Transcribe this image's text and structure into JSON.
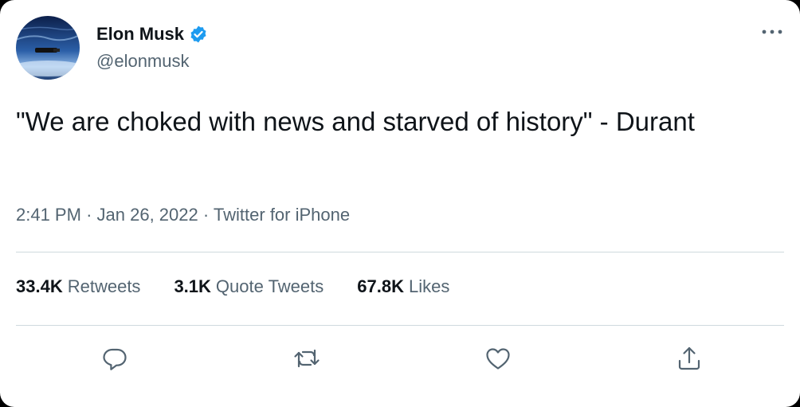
{
  "user": {
    "display_name": "Elon Musk",
    "handle": "@elonmusk",
    "verified": true,
    "avatar_icon": "avatar-earth-from-space"
  },
  "tweet": {
    "text": "\"We are choked with news and starved of history\" - Durant"
  },
  "meta": {
    "time": "2:41 PM",
    "separator_1": "·",
    "date": "Jan 26, 2022",
    "separator_2": "·",
    "source": "Twitter for iPhone"
  },
  "stats": {
    "retweets": {
      "count": "33.4K",
      "label": "Retweets"
    },
    "quote_tweets": {
      "count": "3.1K",
      "label": "Quote Tweets"
    },
    "likes": {
      "count": "67.8K",
      "label": "Likes"
    }
  },
  "actions": {
    "reply_icon": "reply-icon",
    "retweet_icon": "retweet-icon",
    "like_icon": "heart-icon",
    "share_icon": "share-icon"
  },
  "colors": {
    "text_primary": "#0f1419",
    "text_secondary": "#536471",
    "verified_blue": "#1d9bf0",
    "divider": "#cfd9de",
    "background": "#ffffff"
  }
}
